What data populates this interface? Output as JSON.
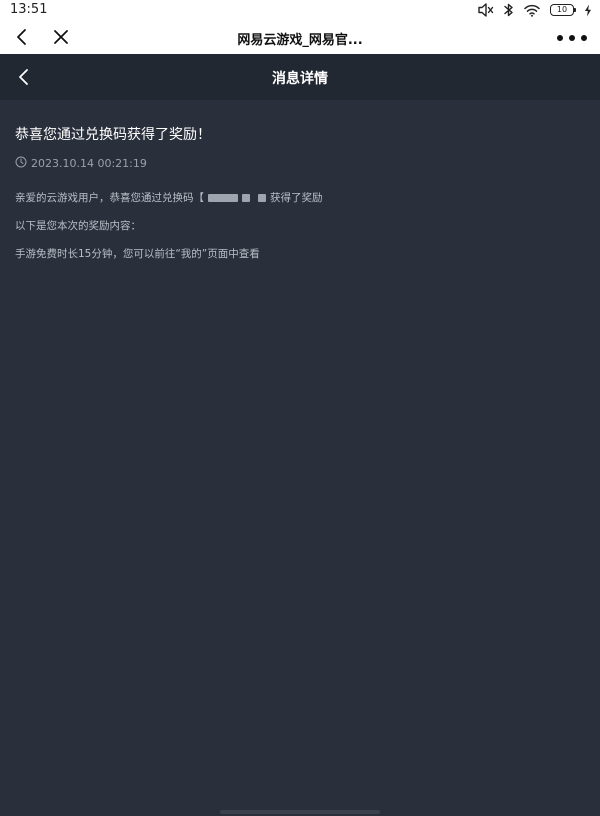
{
  "status_bar": {
    "time": "13:51",
    "battery_level": "10"
  },
  "browser": {
    "title": "网易云游戏_网易官..."
  },
  "header": {
    "title": "消息详情"
  },
  "message": {
    "title": "恭喜您通过兑换码获得了奖励！",
    "timestamp": "2023.10.14 00:21:19",
    "line1_prefix": "亲爱的云游戏用户，恭喜您通过兑换码【",
    "line1_suffix": "获得了奖励",
    "line2": "以下是您本次的奖励内容：",
    "line3": "手游免费时长15分钟，您可以前往“我的”页面中查看"
  },
  "colors": {
    "background": "#2a303b",
    "header": "#222832",
    "text_primary": "#ffffff",
    "text_secondary": "#b9bfc8"
  }
}
